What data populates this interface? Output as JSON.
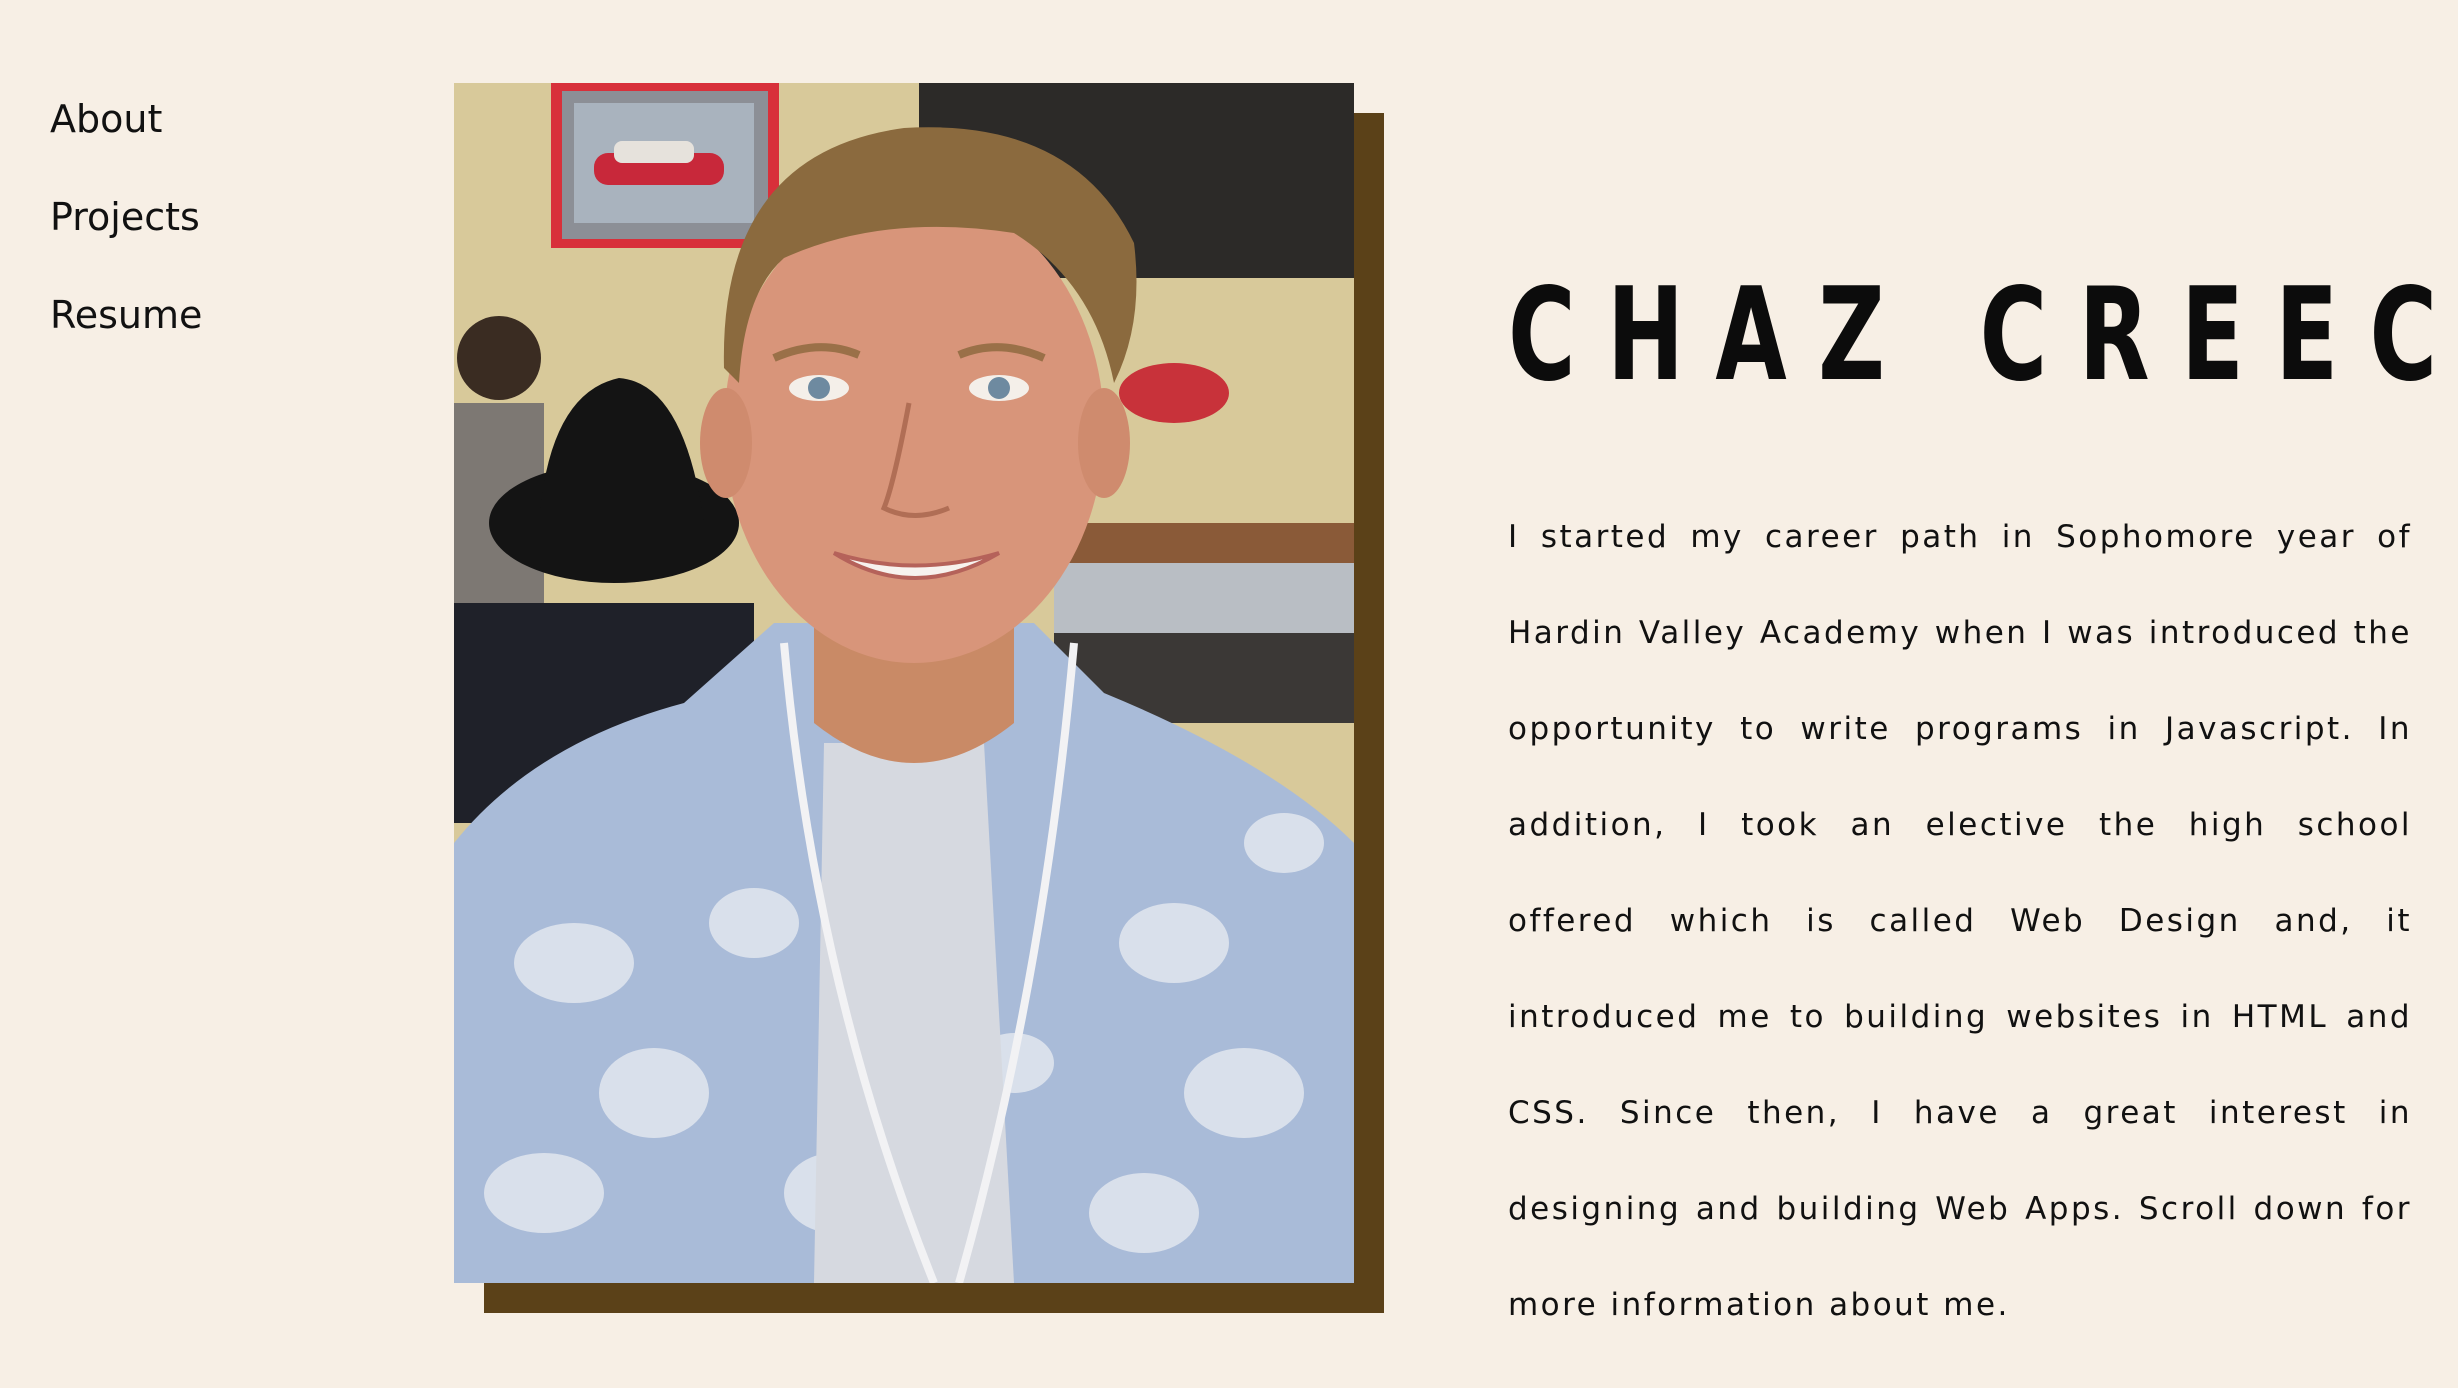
{
  "nav": {
    "items": [
      {
        "label": "About"
      },
      {
        "label": "Projects"
      },
      {
        "label": "Resume"
      }
    ]
  },
  "hero": {
    "name": "CHAZ CREECH",
    "bio": "I started my career path in Sophomore year of Hardin Valley Academy when I was introduced the opportunity to write programs in Javascript. In addition, I took an elective the high school offered which is called Web Design and, it introduced me to building websites in HTML and CSS. Since then, I have a great interest in designing and building Web Apps. Scroll down for more information about me."
  },
  "colors": {
    "background": "#f7efe5",
    "photo_shadow": "#5b4118",
    "text": "#111111"
  }
}
